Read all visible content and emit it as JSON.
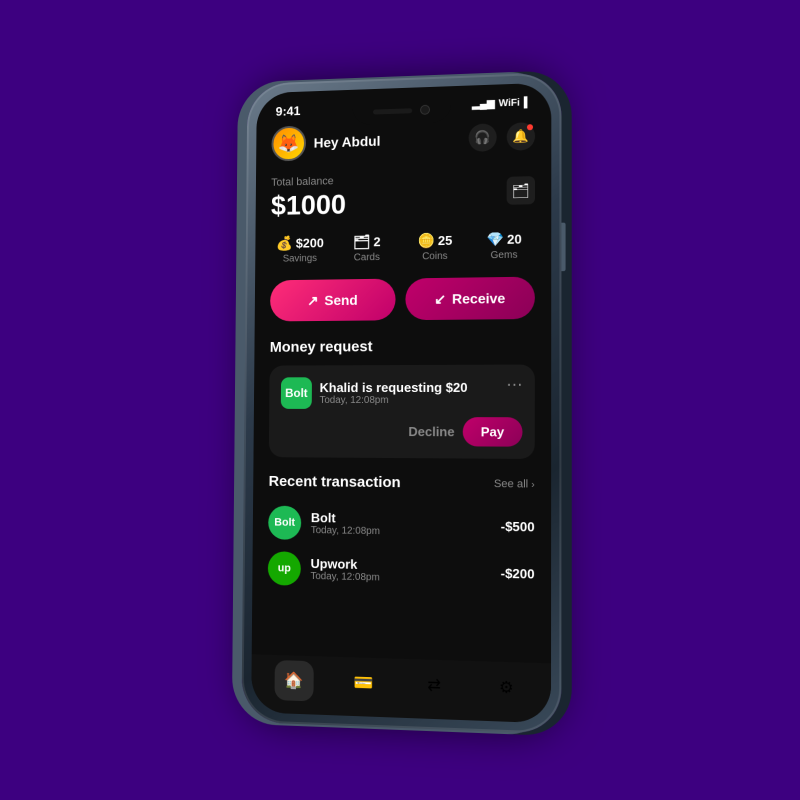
{
  "phone": {
    "status_bar": {
      "time": "9:41",
      "signal": "▂▄▆",
      "wifi": "WiFi",
      "battery": "🔋"
    }
  },
  "header": {
    "greeting": "Hey Abdul",
    "avatar_emoji": "🦊",
    "headphone_icon": "🎧",
    "bell_icon": "🔔"
  },
  "balance": {
    "label": "Total balance",
    "amount": "$1000",
    "card_icon": "🗂"
  },
  "stats": [
    {
      "emoji": "💰",
      "value": "$200",
      "label": "Savings"
    },
    {
      "emoji": "🗂",
      "value": "2",
      "label": "Cards"
    },
    {
      "emoji": "🪙",
      "value": "25",
      "label": "Coins"
    },
    {
      "emoji": "💎",
      "value": "20",
      "label": "Gems"
    }
  ],
  "actions": {
    "send_label": "Send",
    "receive_label": "Receive"
  },
  "money_request": {
    "section_title": "Money request",
    "requester_logo": "Bolt",
    "requester_name": "Khalid is requesting $20",
    "request_time": "Today, 12:08pm",
    "decline_label": "Decline",
    "pay_label": "Pay"
  },
  "recent_transactions": {
    "section_title": "Recent transaction",
    "see_all_label": "See all",
    "items": [
      {
        "name": "Bolt",
        "time": "Today, 12:08pm",
        "amount": "-$500",
        "logo_text": "Bolt",
        "logo_class": "bolt-logo"
      },
      {
        "name": "Upwork",
        "time": "Today, 12:08pm",
        "amount": "-$200",
        "logo_text": "up",
        "logo_class": "upwork-logo"
      }
    ]
  },
  "bottom_nav": {
    "items": [
      {
        "icon": "🏠",
        "label": "home",
        "active": true
      },
      {
        "icon": "💳",
        "label": "cards",
        "active": false
      },
      {
        "icon": "⇄",
        "label": "transfer",
        "active": false
      },
      {
        "icon": "⚙",
        "label": "settings",
        "active": false
      }
    ]
  }
}
